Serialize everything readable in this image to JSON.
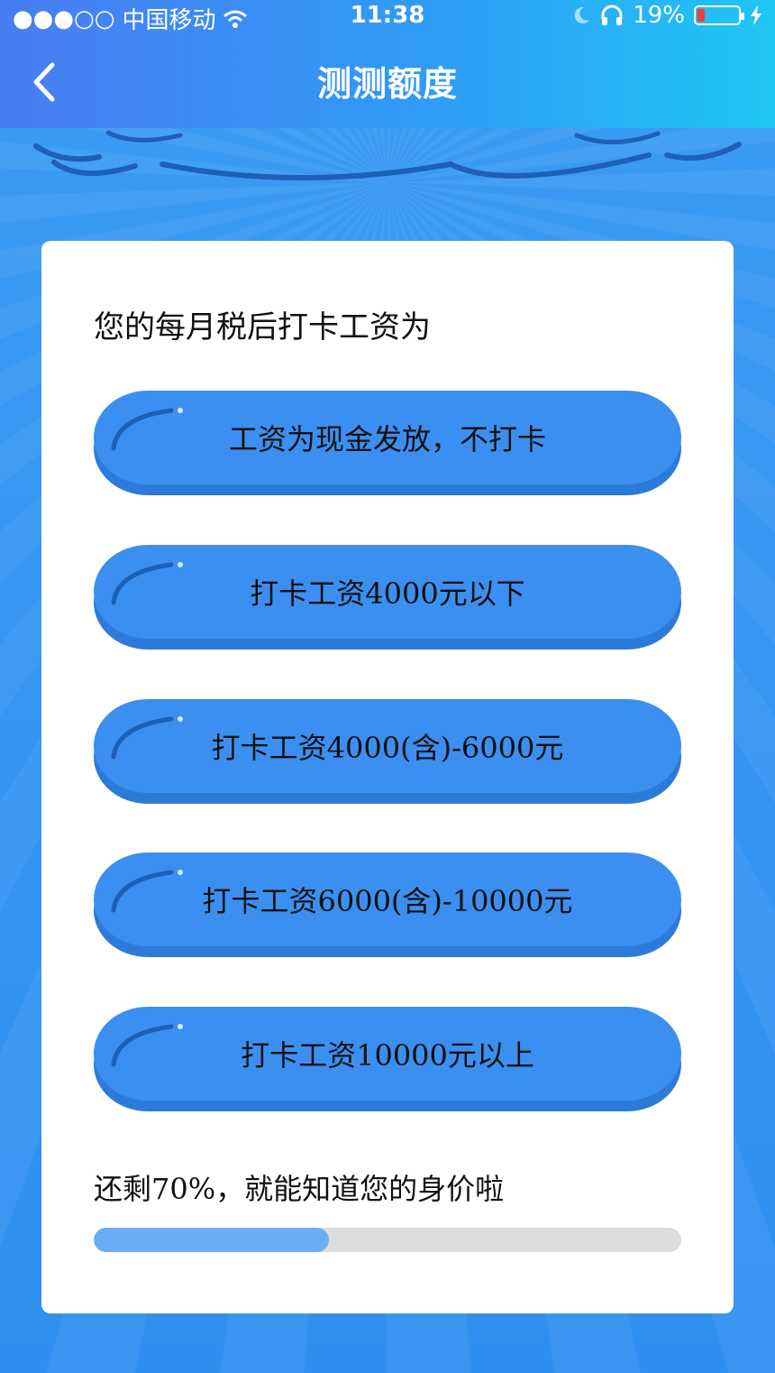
{
  "status_bar": {
    "signal": "●●●○○",
    "carrier": "中国移动",
    "time": "11:38",
    "battery_percent": "19%",
    "battery_level": 0.19
  },
  "nav": {
    "title": "测测额度"
  },
  "quiz": {
    "question": "您的每月税后打卡工资为",
    "options": [
      {
        "label": "工资为现金发放，不打卡"
      },
      {
        "label": "打卡工资4000元以下"
      },
      {
        "label": "打卡工资4000(含)-6000元"
      },
      {
        "label": "打卡工资6000(含)-10000元"
      },
      {
        "label": "打卡工资10000元以上"
      }
    ],
    "progress_text": "还剩70%，就能知道您的身价啦",
    "progress_fraction": 0.4
  },
  "colors": {
    "header_start": "#4a7cf3",
    "header_end": "#1fc6f5",
    "background": "#2f8ff0",
    "option_fill": "#3b8ff0",
    "progress_fill": "#6aaef6"
  }
}
